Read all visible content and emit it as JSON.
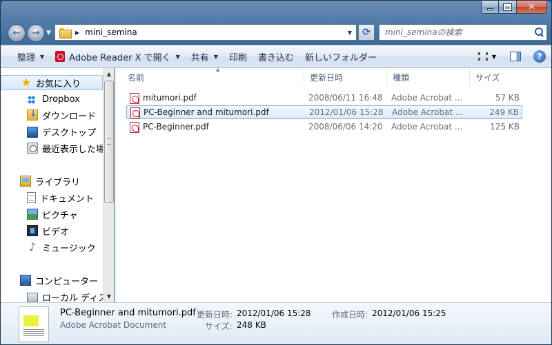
{
  "window": {
    "address_path": "mini_semina",
    "search_placeholder": "mini_seminaの検索"
  },
  "toolbar": {
    "organize": "整理",
    "open_with": "Adobe Reader X で開く",
    "share": "共有",
    "print": "印刷",
    "burn": "書き込む",
    "new_folder": "新しいフォルダー"
  },
  "sidebar": {
    "favorites": "お気に入り",
    "dropbox": "Dropbox",
    "downloads": "ダウンロード",
    "desktop": "デスクトップ",
    "recent": "最近表示した場所",
    "libraries": "ライブラリ",
    "documents": "ドキュメント",
    "pictures": "ピクチャ",
    "videos": "ビデオ",
    "music": "ミュージック",
    "computer": "コンピューター",
    "local_disk": "ローカル ディスク"
  },
  "columns": {
    "name": "名前",
    "date": "更新日時",
    "type": "種類",
    "size": "サイズ"
  },
  "files": [
    {
      "name": "mitumori.pdf",
      "date": "2008/06/11 16:48",
      "type": "Adobe Acrobat ...",
      "size": "57 KB"
    },
    {
      "name": "PC-Beginner and mitumori.pdf",
      "date": "2012/01/06 15:28",
      "type": "Adobe Acrobat ...",
      "size": "249 KB"
    },
    {
      "name": "PC-Beginner.pdf",
      "date": "2008/06/06 14:20",
      "type": "Adobe Acrobat ...",
      "size": "125 KB"
    }
  ],
  "details": {
    "filename": "PC-Beginner and mitumori.pdf",
    "filetype": "Adobe Acrobat Document",
    "modified_label": "更新日時:",
    "modified_value": "2012/01/06 15:28",
    "created_label": "作成日時:",
    "created_value": "2012/01/06 15:25",
    "size_label": "サイズ:",
    "size_value": "248 KB"
  }
}
